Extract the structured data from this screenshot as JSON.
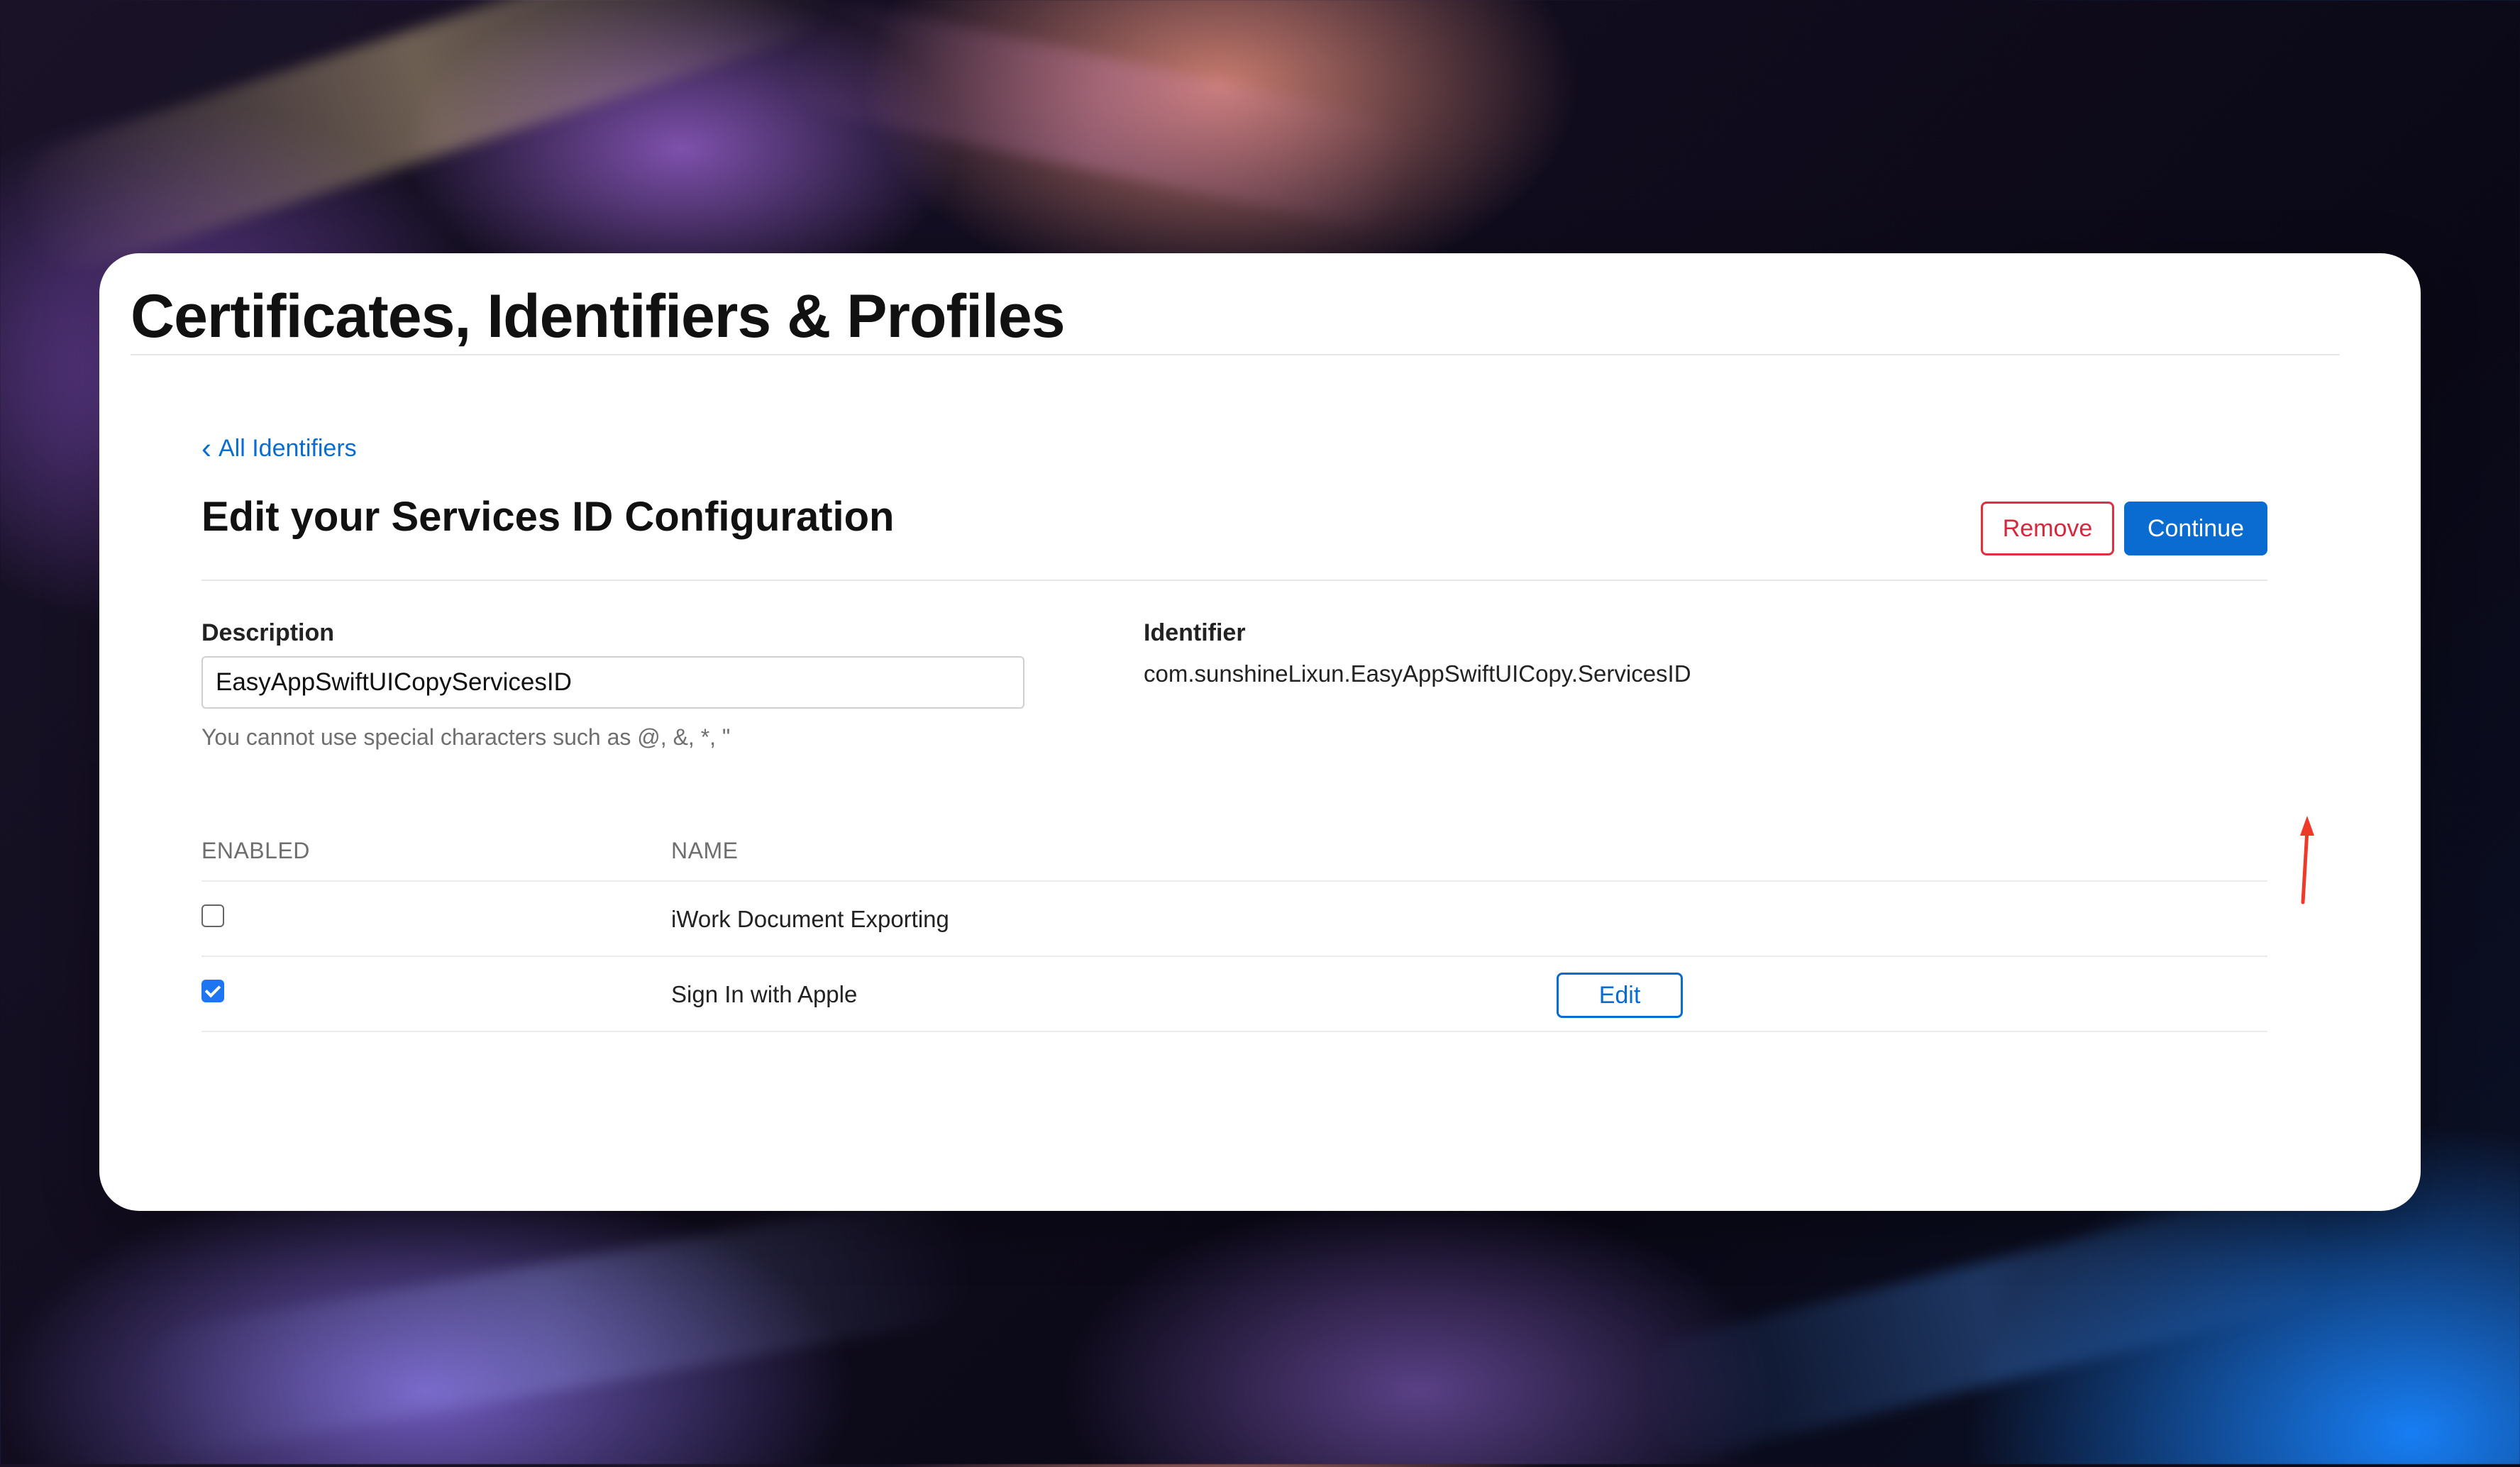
{
  "page": {
    "title": "Certificates, Identifiers & Profiles"
  },
  "navigation": {
    "back_icon": "chevron-left",
    "back_link_label": "All Identifiers"
  },
  "main": {
    "heading": "Edit your Services ID Configuration",
    "actions": {
      "remove_label": "Remove",
      "continue_label": "Continue"
    },
    "description": {
      "label": "Description",
      "value": "EasyAppSwiftUICopyServicesID",
      "help_text": "You cannot use special characters such as @, &, *, \""
    },
    "identifier": {
      "label": "Identifier",
      "value": "com.sunshineLixun.EasyAppSwiftUICopy.ServicesID"
    },
    "capabilities": {
      "headers": {
        "enabled": "ENABLED",
        "name": "NAME"
      },
      "rows": [
        {
          "enabled": false,
          "name": "iWork Document Exporting"
        },
        {
          "enabled": true,
          "name": "Sign In with Apple",
          "action_label": "Edit"
        }
      ]
    }
  },
  "colors": {
    "accent_blue": "#0a6cd0",
    "remove_red": "#d6283c",
    "checkbox_blue": "#1d75f2",
    "annotation_red": "#ef3a2a"
  }
}
